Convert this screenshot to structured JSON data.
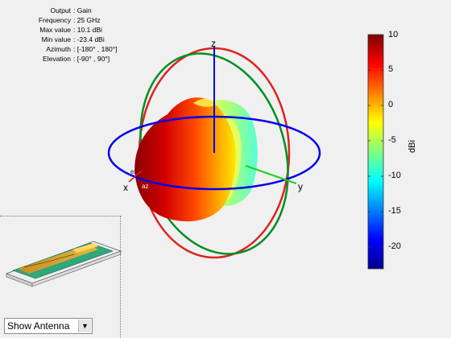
{
  "info": [
    {
      "key": "Output",
      "value": ": Gain"
    },
    {
      "key": "Frequency",
      "value": ": 25 GHz"
    },
    {
      "key": "Max value",
      "value": ": 10.1 dBi"
    },
    {
      "key": "Min value",
      "value": ": -23.4 dBi"
    },
    {
      "key": "Azimuth",
      "value": ": [-180° , 180°]"
    },
    {
      "key": "Elevation",
      "value": ": [-90° , 90°]"
    }
  ],
  "axes": {
    "x": "x",
    "y": "y",
    "z": "z",
    "az": "az",
    "el": "el"
  },
  "colorbar": {
    "unit": "dBi",
    "min": -23.4,
    "max": 10.1,
    "ticks": [
      "10",
      "5",
      "0",
      "-5",
      "-10",
      "-15",
      "-20"
    ],
    "colormap": "jet"
  },
  "control": {
    "select_label": "Show Antenna"
  },
  "colors": {
    "azimuth_ring": "#0000ee",
    "elevation_ring": "#009020",
    "meridian_ring": "#dd2222"
  }
}
